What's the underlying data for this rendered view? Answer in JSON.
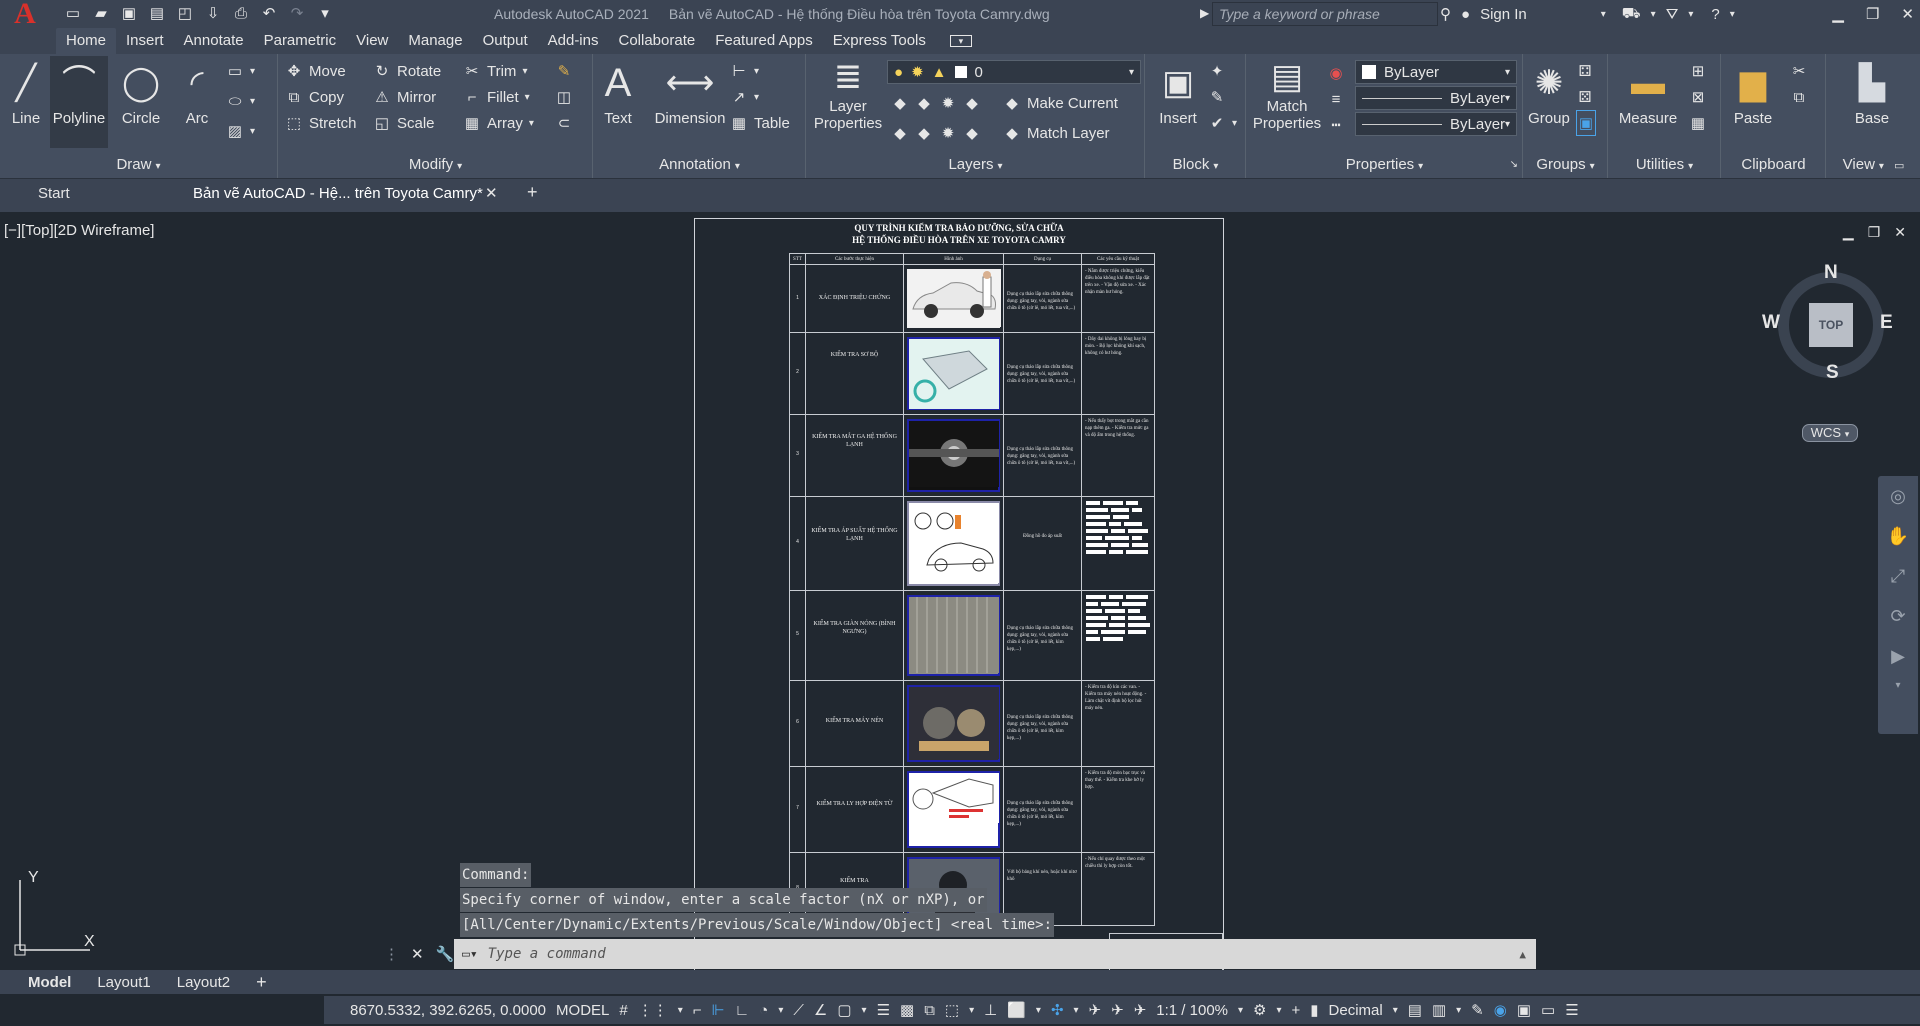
{
  "app": {
    "logo": "A",
    "title": "Autodesk AutoCAD 2021",
    "document": "Bản vẽ AutoCAD - Hệ thống Điều hòa trên Toyota Camry.dwg"
  },
  "search": {
    "placeholder": "Type a keyword or phrase"
  },
  "account": {
    "sign_in": "Sign In"
  },
  "ribbon_tabs": [
    "Home",
    "Insert",
    "Annotate",
    "Parametric",
    "View",
    "Manage",
    "Output",
    "Add-ins",
    "Collaborate",
    "Featured Apps",
    "Express Tools"
  ],
  "draw": {
    "title": "Draw",
    "line": "Line",
    "polyline": "Polyline",
    "circle": "Circle",
    "arc": "Arc"
  },
  "modify": {
    "title": "Modify",
    "move": "Move",
    "rotate": "Rotate",
    "trim": "Trim",
    "copy": "Copy",
    "mirror": "Mirror",
    "fillet": "Fillet",
    "stretch": "Stretch",
    "scale": "Scale",
    "array": "Array"
  },
  "annotation": {
    "title": "Annotation",
    "text": "Text",
    "dimension": "Dimension",
    "table": "Table"
  },
  "layers": {
    "title": "Layers",
    "layer_properties_1": "Layer",
    "layer_properties_2": "Properties",
    "current_layer": "0",
    "make_current": "Make Current",
    "match_layer": "Match Layer"
  },
  "block": {
    "title": "Block",
    "insert": "Insert"
  },
  "properties": {
    "title": "Properties",
    "match_1": "Match",
    "match_2": "Properties",
    "color": "ByLayer",
    "linetype": "ByLayer",
    "lineweight": "ByLayer"
  },
  "groups": {
    "title": "Groups",
    "group": "Group"
  },
  "utilities": {
    "title": "Utilities",
    "measure": "Measure"
  },
  "clipboard": {
    "title": "Clipboard",
    "paste": "Paste"
  },
  "view": {
    "title": "View",
    "base": "Base"
  },
  "file_tabs": {
    "start": "Start",
    "drawing": "Bản vẽ AutoCAD - Hệ... trên Toyota Camry*"
  },
  "viewport": {
    "label": "[−][Top][2D Wireframe]"
  },
  "viewcube": {
    "n": "N",
    "s": "S",
    "e": "E",
    "w": "W",
    "top": "TOP",
    "wcs": "WCS"
  },
  "drawing": {
    "title_1": "QUY TRÌNH KIỂM TRA BẢO DƯỠNG, SỬA CHỮA",
    "title_2": "HỆ THỐNG ĐIỀU HÒA TRÊN XE TOYOTA CAMRY",
    "headers": [
      "STT",
      "Các bước thực hiện",
      "Hình ảnh",
      "Dụng cụ",
      "Các yêu cầu kỹ thuật"
    ],
    "rows": [
      {
        "no": "1",
        "step": "XÁC ĐỊNH TRIỆU CHỨNG",
        "tool": "Dụng cụ tháo lắp sửa chữa thông dụng: găng tay, vòi, ngành sửa chữa ô tô (cờ lê, mỏ lết, tua vít,...)",
        "req": "- Nắm được triệu chứng, kiểu điều hòa không khí được lắp đặt trên xe. - Vận độ sửa xe. - Xác nhận màn hư hỏng."
      },
      {
        "no": "2",
        "step": "KIỂM TRA SƠ BỘ",
        "tool": "Dụng cụ tháo lắp sửa chữa thông dụng: găng tay, vòi, ngành sửa chữa ô tô (cờ lê, mỏ lết, tua vít,...)",
        "req": "- Dây đai không bị lỏng hay bị mòn. - Bộ lọc không khí sạch, không có hư hỏng."
      },
      {
        "no": "3",
        "step": "KIỂM TRA MẮT GA HỆ THỐNG LẠNH",
        "tool": "Dụng cụ tháo lắp sửa chữa thông dụng: găng tay, vòi, ngành sửa chữa ô tô (cờ lê, mỏ lết, tua vít,...)",
        "req": "- Nếu thấy bọt trong mắt ga cần nạp thêm ga. - Kiểm tra mức ga và độ ẩm trong hệ thống."
      },
      {
        "no": "4",
        "step": "KIỂM TRA ÁP SUẤT HỆ THỐNG LẠNH",
        "tool": "Đồng hồ đo áp suất",
        "req": ""
      },
      {
        "no": "5",
        "step": "KIỂM TRA GIÀN NÓNG (BÌNH NGƯNG)",
        "tool": "Dụng cụ tháo lắp sửa chữa thông dụng: găng tay, vòi, ngành sửa chữa ô tô (cờ lê, mỏ lết, kìm kẹp,...)",
        "req": ""
      },
      {
        "no": "6",
        "step": "KIỂM TRA MÁY NÉN",
        "tool": "Dụng cụ tháo lắp sửa chữa thông dụng: găng tay, vòi, ngành sửa chữa ô tô (cờ lê, mỏ lết, kìm kẹp,...)",
        "req": "- Kiểm tra độ kín các van. - Kiểm tra máy nén hoạt động. - Làm chặt vít định bộ lọc hút máy nén."
      },
      {
        "no": "7",
        "step": "KIỂM TRA LY HỢP ĐIỆN TỪ",
        "tool": "Dụng cụ tháo lắp sửa chữa thông dụng: găng tay, vòi, ngành sửa chữa ô tô (cờ lê, mỏ lết, kìm kẹp,...)",
        "req": "- Kiểm tra độ mòn bạc trục và thay thế. - Kiểm tra khe hở ly hợp."
      },
      {
        "no": "8",
        "step": "KIỂM TRA",
        "tool": "Với bộ bảng khí nén, hoặc khí nitơ khô",
        "req": "- Nếu chỉ quay được theo một chiều thì ly hợp còn tốt."
      }
    ]
  },
  "command": {
    "history": [
      "Command:",
      "Specify corner of window, enter a scale factor (nX or nXP), or",
      "[All/Center/Dynamic/Extents/Previous/Scale/Window/Object] <real time>:"
    ],
    "placeholder": "Type a command"
  },
  "ucs": {
    "x": "X",
    "y": "Y"
  },
  "layout_tabs": [
    "Model",
    "Layout1",
    "Layout2"
  ],
  "status": {
    "coords": "8670.5332, 392.6265, 0.0000",
    "model": "MODEL",
    "scale": "1:1 / 100%",
    "units": "Decimal"
  }
}
